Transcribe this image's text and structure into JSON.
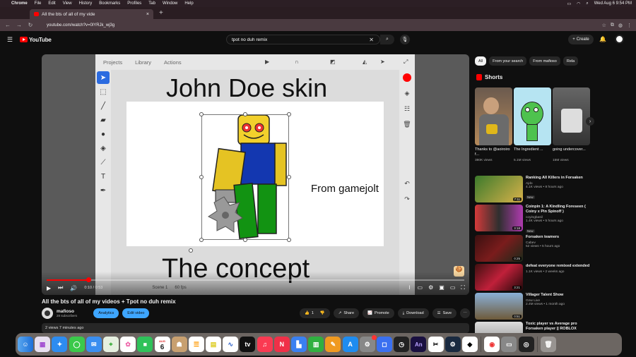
{
  "menubar": {
    "app": "Chrome",
    "items": [
      "File",
      "Edit",
      "View",
      "History",
      "Bookmarks",
      "Profiles",
      "Tab",
      "Window",
      "Help"
    ],
    "datetime": "Wed Aug 6  9:54 PM"
  },
  "tab": {
    "title": "All the bts of all of my vide",
    "close": "×",
    "new": "+"
  },
  "address": {
    "url": "youtube.com/watch?v=0lYRJk_wj3g"
  },
  "yt": {
    "logo": "YouTube",
    "search_value": "tpot no duh remix",
    "create_label": "Create"
  },
  "video": {
    "app_nav": [
      "Projects",
      "Library",
      "Actions"
    ],
    "text_top": "John Doe skin",
    "text_bottom": "The concept",
    "text_side": "From gamejolt",
    "time": "0:10 / 0:53",
    "scene": "Scene 1",
    "fps": "60 fps",
    "progress": 0.1
  },
  "meta": {
    "title": "All the bts of all of my videos + Tpot no duh remix",
    "channel": "mafioso",
    "subs": "28 subscribers",
    "analytics": "Analytics",
    "edit_video": "Edit video",
    "likes": "1",
    "share": "Share",
    "promote": "Promote",
    "download": "Download",
    "save": "Save",
    "desc": "2 views  7 minutes ago"
  },
  "chips": [
    "All",
    "From your search",
    "From mafioso",
    "Rela"
  ],
  "shorts": {
    "heading": "Shorts",
    "items": [
      {
        "title": "Thanks to @aoiroiro f...",
        "views": "380K views"
      },
      {
        "title": "The Ingredient ...",
        "views": "5.1M views"
      },
      {
        "title": "going undercover...",
        "views": "15M views"
      }
    ]
  },
  "recs": [
    {
      "title": "Ranking All Killers in Forsaken",
      "channel": "Ajdo",
      "meta": "4.1K views • 8 hours ago",
      "badge": "New",
      "dur": "7:11"
    },
    {
      "title": "Coinpin 1: A Kindling Foreseen ( Coiny x Pin Spinoff )",
      "channel": "coyingbasil",
      "meta": "1.4K views • 5 hours ago",
      "badge": "New",
      "dur": "3:18"
    },
    {
      "title": "Forsaken teamers",
      "channel": "Cabev",
      "meta": "52 views • 5 hours ago",
      "badge": "",
      "dur": "0:25"
    },
    {
      "title": "defeat everyone remixed extended",
      "channel": "",
      "meta": "1.1K views • 2 weeks ago",
      "badge": "",
      "dur": "3:21"
    },
    {
      "title": "Villager Talent Show",
      "channel": "Gnw Live",
      "meta": "2.4M views • 1 month ago",
      "badge": "",
      "dur": "0:51"
    },
    {
      "title": "Toxic player vs Average pro Forsaken player || ROBLOX",
      "channel": "",
      "meta": "",
      "badge": "",
      "dur": ""
    }
  ],
  "dock": {
    "calendar_month": "AUG",
    "calendar_day": "6"
  }
}
